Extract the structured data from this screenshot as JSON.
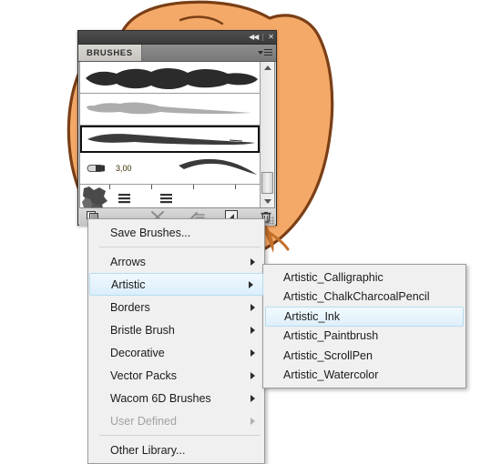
{
  "artwork": {
    "name": "orange-blob-illustration",
    "fill": "#F5A968",
    "outline": "#7A3F16",
    "accent": "#C4702A"
  },
  "panel": {
    "title": "BRUSHES",
    "titlebar": {
      "collapse_label": "◀◀",
      "close_label": "✕"
    },
    "menu_icon_name": "panel-menu-icon",
    "brushes": [
      {
        "name": "calligraphic-thick-stroke",
        "type": "art",
        "selected": false
      },
      {
        "name": "art-tapered-gray-stroke",
        "type": "art",
        "selected": false
      },
      {
        "name": "art-ink-dark-stroke",
        "type": "art",
        "selected": true
      },
      {
        "name": "calligraphic-3pt",
        "type": "calligraphic",
        "size_label": "3,00",
        "selected": false
      },
      {
        "name": "pattern-brush-tiles",
        "type": "pattern",
        "selected": false
      }
    ],
    "footer_buttons": [
      {
        "name": "brush-libraries-menu-button",
        "label": "Brush Libraries Menu"
      },
      {
        "name": "remove-brush-stroke-button",
        "label": "Remove Brush Stroke"
      },
      {
        "name": "options-of-selected-object-button",
        "label": "Options of Selected Object"
      },
      {
        "name": "new-brush-button",
        "label": "New Brush"
      },
      {
        "name": "delete-brush-button",
        "label": "Delete Brush"
      }
    ],
    "scrollbar": {
      "up_label": "▲",
      "down_label": "▼"
    }
  },
  "context_menu": {
    "items": [
      {
        "label": "Save Brushes...",
        "submenu": false,
        "disabled": false,
        "highlighted": false,
        "separator_after": true
      },
      {
        "label": "Arrows",
        "submenu": true,
        "disabled": false,
        "highlighted": false,
        "separator_after": false
      },
      {
        "label": "Artistic",
        "submenu": true,
        "disabled": false,
        "highlighted": true,
        "separator_after": false
      },
      {
        "label": "Borders",
        "submenu": true,
        "disabled": false,
        "highlighted": false,
        "separator_after": false
      },
      {
        "label": "Bristle Brush",
        "submenu": true,
        "disabled": false,
        "highlighted": false,
        "separator_after": false
      },
      {
        "label": "Decorative",
        "submenu": true,
        "disabled": false,
        "highlighted": false,
        "separator_after": false
      },
      {
        "label": "Vector Packs",
        "submenu": true,
        "disabled": false,
        "highlighted": false,
        "separator_after": false
      },
      {
        "label": "Wacom 6D Brushes",
        "submenu": true,
        "disabled": false,
        "highlighted": false,
        "separator_after": false
      },
      {
        "label": "User Defined",
        "submenu": true,
        "disabled": true,
        "highlighted": false,
        "separator_after": true
      },
      {
        "label": "Other Library...",
        "submenu": false,
        "disabled": false,
        "highlighted": false,
        "separator_after": false
      }
    ]
  },
  "submenu": {
    "parent": "Artistic",
    "items": [
      {
        "label": "Artistic_Calligraphic",
        "highlighted": false
      },
      {
        "label": "Artistic_ChalkCharcoalPencil",
        "highlighted": false
      },
      {
        "label": "Artistic_Ink",
        "highlighted": true
      },
      {
        "label": "Artistic_Paintbrush",
        "highlighted": false
      },
      {
        "label": "Artistic_ScrollPen",
        "highlighted": false
      },
      {
        "label": "Artistic_Watercolor",
        "highlighted": false
      }
    ]
  },
  "colors": {
    "highlight_fill": "#dbeefb",
    "highlight_border": "#b5dcf0",
    "menu_bg": "#f0f0f0",
    "panel_chrome": "#3b3b3b"
  }
}
